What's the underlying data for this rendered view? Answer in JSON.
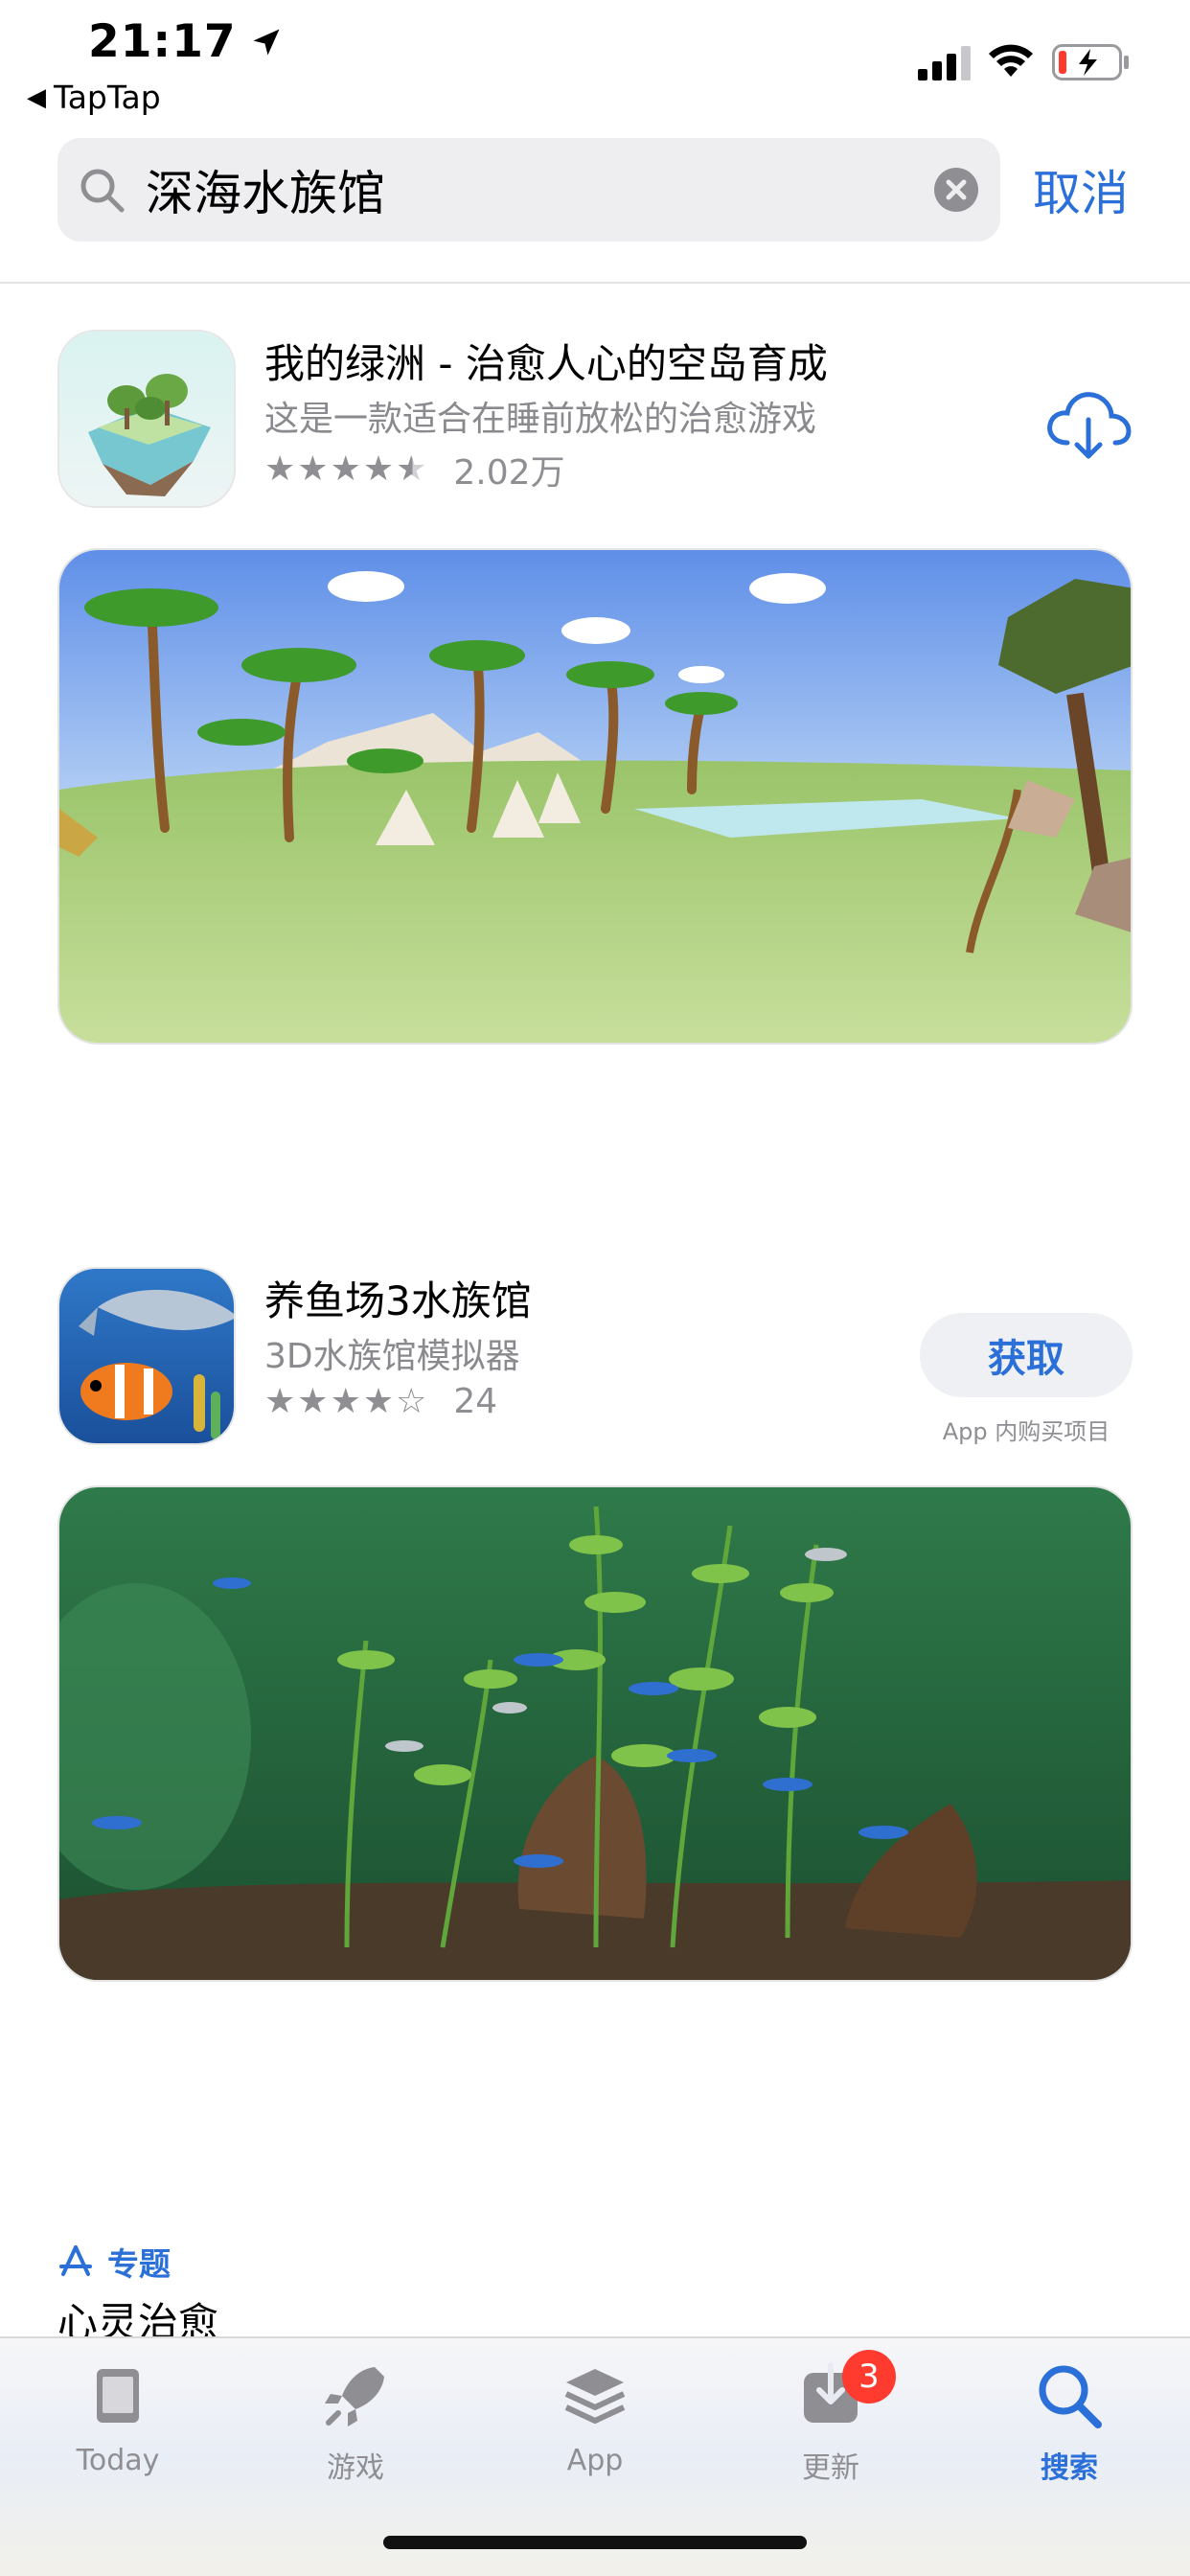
{
  "status_bar": {
    "time": "21:17",
    "back_app": "TapTap"
  },
  "search": {
    "query": "深海水族馆",
    "cancel_label": "取消"
  },
  "results": [
    {
      "name": "我的绿洲 - 治愈人心的空岛育成",
      "subtitle": "这是一款适合在睡前放松的治愈游戏",
      "rating_stars": 4.5,
      "rating_count": "2.02万",
      "action": "redownload-cloud-icon"
    },
    {
      "name": "养鱼场3水族馆",
      "subtitle": "3D水族馆模拟器",
      "rating_stars": 4,
      "rating_count": "24",
      "get_label": "获取",
      "iap_note": "App 内购买项目"
    }
  ],
  "featured": {
    "tag": "专题",
    "title": "心灵治愈"
  },
  "tab_bar": {
    "tabs": [
      {
        "label": "Today",
        "icon": "today-icon"
      },
      {
        "label": "游戏",
        "icon": "rocket-icon"
      },
      {
        "label": "App",
        "icon": "app-stack-icon"
      },
      {
        "label": "更新",
        "icon": "updates-icon",
        "badge": "3"
      },
      {
        "label": "搜索",
        "icon": "search-icon",
        "active": true
      }
    ]
  },
  "colors": {
    "accent": "#2b6fd8",
    "badge": "#ff3b30",
    "secondary_text": "#8a8a8e"
  }
}
